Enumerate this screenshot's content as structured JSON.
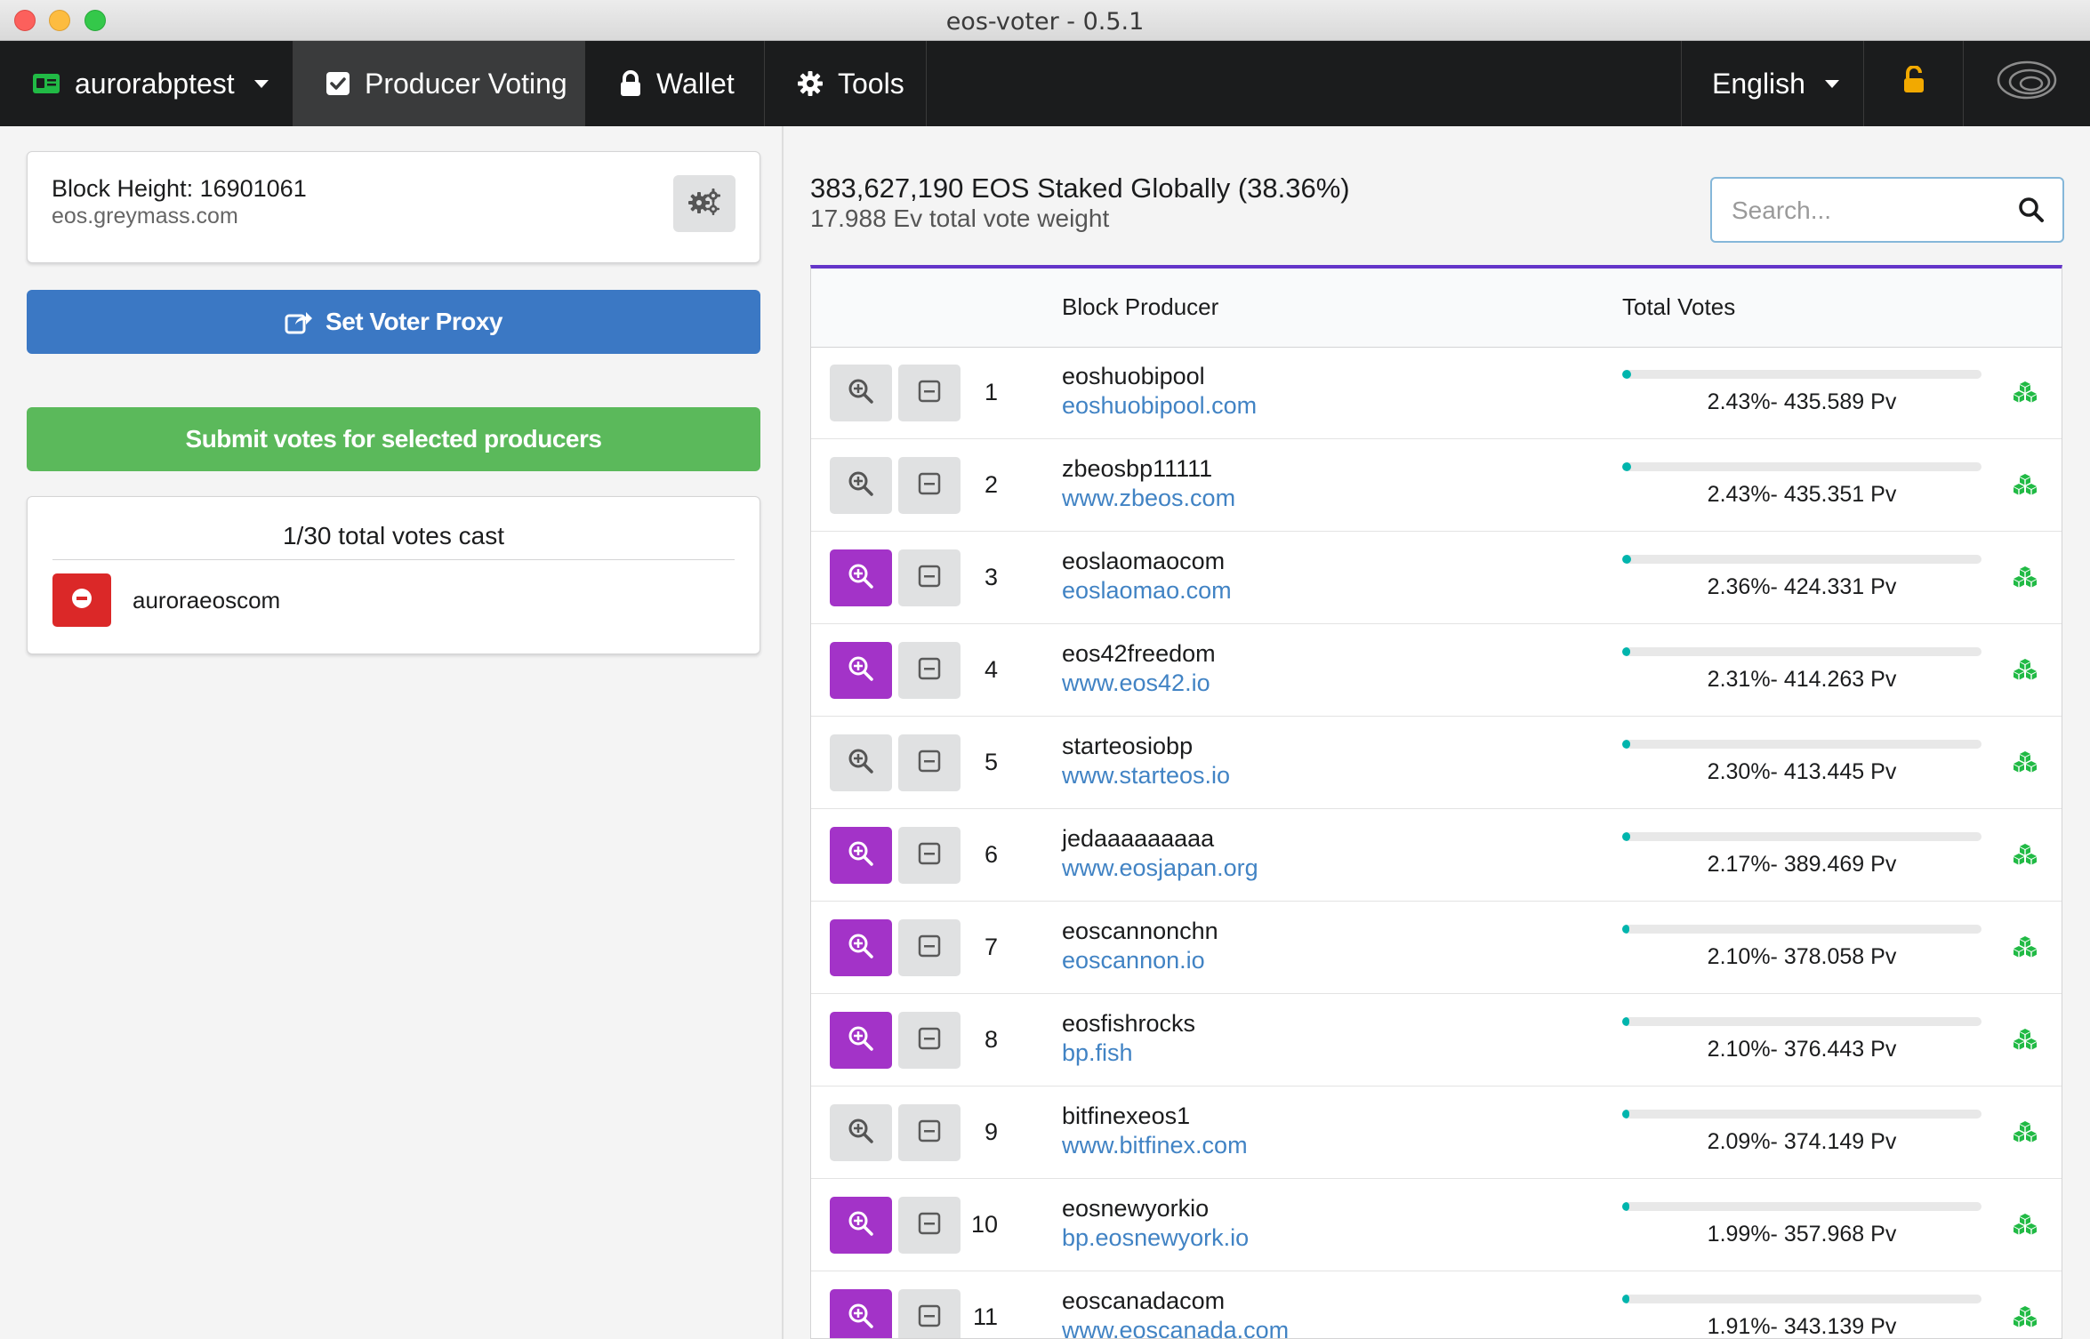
{
  "window": {
    "title": "eos-voter - 0.5.1"
  },
  "menu": {
    "account": "aurorabptest",
    "producer_voting": "Producer Voting",
    "wallet": "Wallet",
    "tools": "Tools",
    "language": "English"
  },
  "node": {
    "block_height": "Block Height: 16901061",
    "host": "eos.greymass.com"
  },
  "buttons": {
    "set_voter_proxy": "Set Voter Proxy",
    "submit_votes": "Submit votes for selected producers"
  },
  "votes_cast": {
    "title": "1/30 total votes cast",
    "selected": [
      "auroraeoscom"
    ]
  },
  "stats": {
    "staked": "383,627,190 EOS Staked Globally (38.36%)",
    "vote_weight": "17.988 Ev total vote weight"
  },
  "search": {
    "placeholder": "Search...",
    "value": ""
  },
  "colors": {
    "selected": "#a333c8",
    "accent": "#6435c9",
    "bar": "#00b5ad",
    "link": "#4183c4"
  },
  "table": {
    "headers": {
      "producer": "Block Producer",
      "votes": "Total Votes"
    },
    "rows": [
      {
        "rank": "1",
        "name": "eoshuobipool",
        "url": "eoshuobipool.com",
        "votes": "2.43%- 435.589 Pv",
        "percent": 2.43,
        "selected": false
      },
      {
        "rank": "2",
        "name": "zbeosbp11111",
        "url": "www.zbeos.com",
        "votes": "2.43%- 435.351 Pv",
        "percent": 2.43,
        "selected": false
      },
      {
        "rank": "3",
        "name": "eoslaomaocom",
        "url": "eoslaomao.com",
        "votes": "2.36%- 424.331 Pv",
        "percent": 2.36,
        "selected": true
      },
      {
        "rank": "4",
        "name": "eos42freedom",
        "url": "www.eos42.io",
        "votes": "2.31%- 414.263 Pv",
        "percent": 2.31,
        "selected": true
      },
      {
        "rank": "5",
        "name": "starteosiobp",
        "url": "www.starteos.io",
        "votes": "2.30%- 413.445 Pv",
        "percent": 2.3,
        "selected": false
      },
      {
        "rank": "6",
        "name": "jedaaaaaaaaa",
        "url": "www.eosjapan.org",
        "votes": "2.17%- 389.469 Pv",
        "percent": 2.17,
        "selected": true
      },
      {
        "rank": "7",
        "name": "eoscannonchn",
        "url": "eoscannon.io",
        "votes": "2.10%- 378.058 Pv",
        "percent": 2.1,
        "selected": true
      },
      {
        "rank": "8",
        "name": "eosfishrocks",
        "url": "bp.fish",
        "votes": "2.10%- 376.443 Pv",
        "percent": 2.1,
        "selected": true
      },
      {
        "rank": "9",
        "name": "bitfinexeos1",
        "url": "www.bitfinex.com",
        "votes": "2.09%- 374.149 Pv",
        "percent": 2.09,
        "selected": false
      },
      {
        "rank": "10",
        "name": "eosnewyorkio",
        "url": "bp.eosnewyork.io",
        "votes": "1.99%- 357.968 Pv",
        "percent": 1.99,
        "selected": true
      },
      {
        "rank": "11",
        "name": "eoscanadacom",
        "url": "www.eoscanada.com",
        "votes": "1.91%- 343.139 Pv",
        "percent": 1.91,
        "selected": true
      }
    ]
  }
}
